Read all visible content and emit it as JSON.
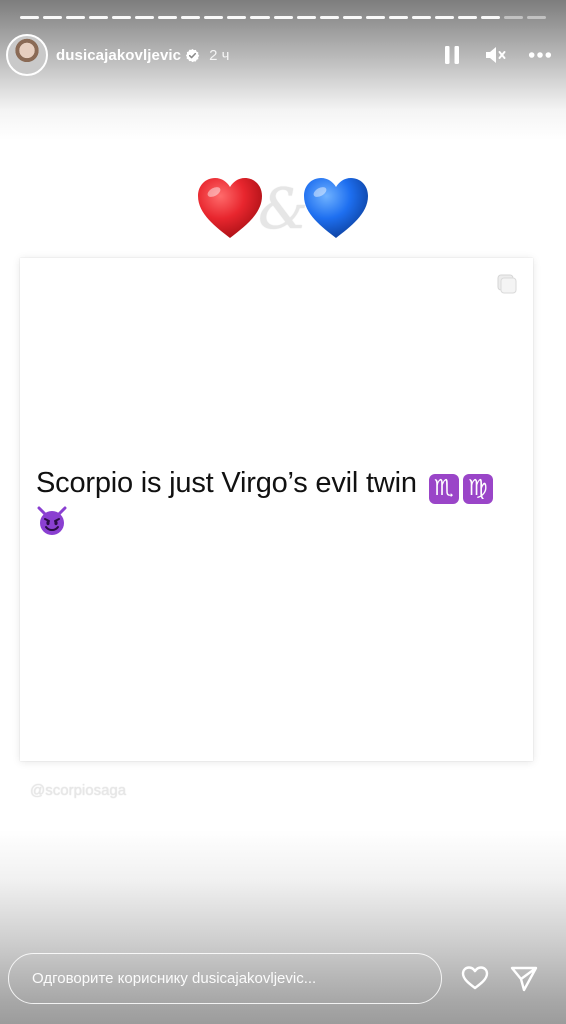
{
  "story": {
    "progress_segments": [
      {
        "state": "seen"
      },
      {
        "state": "seen"
      },
      {
        "state": "seen"
      },
      {
        "state": "seen"
      },
      {
        "state": "seen"
      },
      {
        "state": "seen"
      },
      {
        "state": "seen"
      },
      {
        "state": "seen"
      },
      {
        "state": "seen"
      },
      {
        "state": "seen"
      },
      {
        "state": "seen"
      },
      {
        "state": "seen"
      },
      {
        "state": "seen"
      },
      {
        "state": "seen"
      },
      {
        "state": "seen"
      },
      {
        "state": "seen"
      },
      {
        "state": "seen"
      },
      {
        "state": "seen"
      },
      {
        "state": "seen"
      },
      {
        "state": "seen"
      },
      {
        "state": "current"
      },
      {
        "state": "pending"
      },
      {
        "state": "pending"
      }
    ]
  },
  "header": {
    "username": "dusicajakovljevic",
    "time": "2 ч",
    "verified_icon": "verified-badge-icon",
    "controls": [
      "pause-icon",
      "mute-icon",
      "more-icon"
    ]
  },
  "content": {
    "hearts": [
      "red-heart-icon",
      "blue-heart-icon"
    ],
    "ampersand": "&",
    "quote_text": "Scorpio is just Virgo’s evil twin",
    "zodiac_symbols": [
      "♏",
      "♍"
    ],
    "emoji_icon": "smiling-devil-icon",
    "source_handle": "@scorpiosaga",
    "card_corner_icon": "copy-icon"
  },
  "reply": {
    "placeholder": "Одговорите кориснику dusicajakovljevic...",
    "like_icon": "heart-outline-icon",
    "send_icon": "send-icon"
  },
  "colors": {
    "zodiac_tile": "#9a45c8",
    "heart_red": "#e8262e",
    "heart_blue": "#1e6ff0",
    "devil_purple": "#8a3fd1"
  }
}
